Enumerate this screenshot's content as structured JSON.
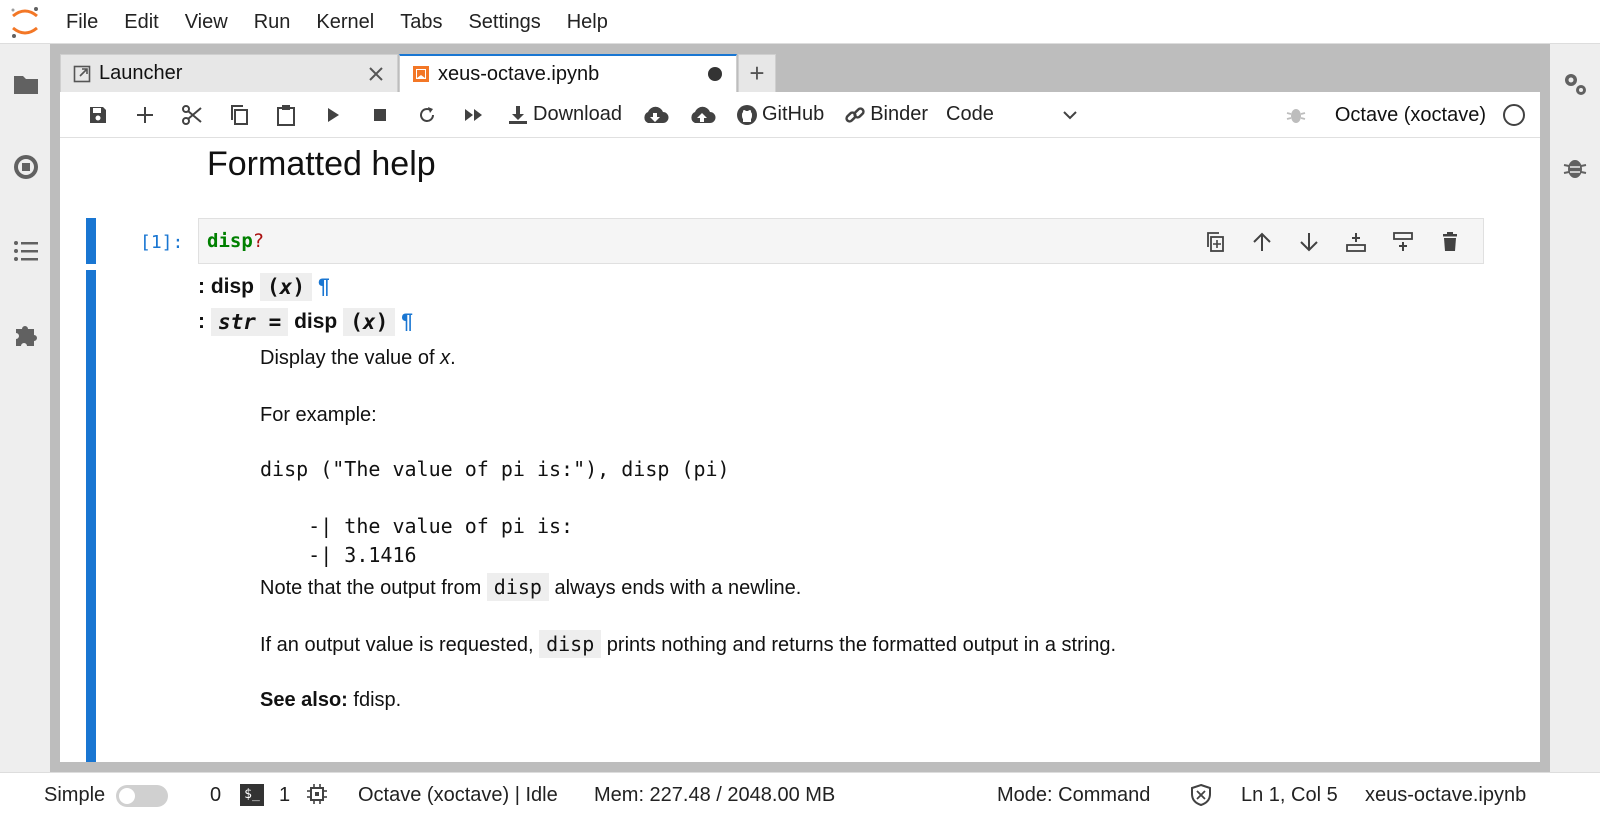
{
  "menu": [
    "File",
    "Edit",
    "View",
    "Run",
    "Kernel",
    "Tabs",
    "Settings",
    "Help"
  ],
  "tabs": {
    "launcher_label": "Launcher",
    "notebook_label": "xeus-octave.ipynb"
  },
  "toolbar": {
    "download_label": "Download",
    "github_label": "GitHub",
    "binder_label": "Binder",
    "cell_type": "Code",
    "kernel_name": "Octave (xoctave)"
  },
  "notebook": {
    "heading": "Formatted help",
    "cell_prompt": "[1]:",
    "cell_code": "disp",
    "cell_code_suffix": "?",
    "output": {
      "sig1_prefix": ":",
      "sig1_name": "disp",
      "sig1_args_open": "(",
      "sig1_arg": "x",
      "sig1_args_close": ")",
      "pilcrow": "¶",
      "sig2_prefix": ":",
      "sig2_ret": "str",
      "sig2_eq": "=",
      "sig2_name": "disp",
      "sig2_args_open": "(",
      "sig2_arg": "x",
      "sig2_args_close": ")",
      "line1_text": "Display the value of ",
      "line1_var": "x",
      "line1_end": ".",
      "line2": "For example:",
      "example_code": "disp (\"The value of pi is:\"), disp (pi)",
      "example_out1": "    -| the value of pi is:",
      "example_out2": "    -| 3.1416",
      "note_before": "Note that the output from ",
      "note_code": "disp",
      "note_after": " always ends with a newline.",
      "req_before": "If an output value is requested, ",
      "req_code": "disp",
      "req_after": " prints nothing and returns the formatted output in a string.",
      "see_also_label": "See also:",
      "see_also_value": " fdisp."
    }
  },
  "status": {
    "mode_label": "Simple",
    "terminals": "0",
    "kernels": "1",
    "kernel_status": "Octave (xoctave) | Idle",
    "memory": "Mem: 227.48 / 2048.00 MB",
    "command_mode": "Mode: Command",
    "cursor": "Ln 1, Col 5",
    "file": "xeus-octave.ipynb"
  },
  "colors": {
    "accent": "#1976d2",
    "code_green": "#008000",
    "logo_orange": "#f37726"
  }
}
